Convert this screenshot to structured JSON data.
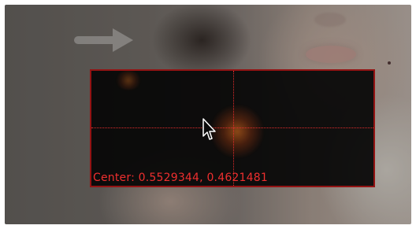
{
  "overlay": {
    "center_text": "Center: 0.5529344, 0.4621481"
  },
  "colors": {
    "accent_red": "#ff2a2a",
    "border_red": "#9e1010"
  },
  "icons": {
    "cursor": "mouse-pointer-icon"
  }
}
